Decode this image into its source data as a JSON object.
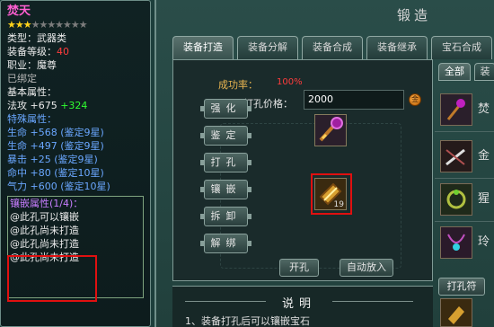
{
  "tooltip": {
    "item_name": "焚天",
    "stars_filled": 3,
    "stars_total": 10,
    "type_label": "类型：",
    "type_value": "武器类",
    "level_label": "装备等级：",
    "level_value": "40",
    "class_label": "职业：",
    "class_value": "魔尊",
    "bound": "已绑定",
    "base_attr_title": "基本属性：",
    "base_attr_name": "法攻",
    "base_attr_value": "+675",
    "base_attr_bonus": "+324",
    "special_attr_title": "特殊属性：",
    "special_attrs": [
      {
        "name": "生命",
        "value": "+568",
        "note": "(鉴定9星)"
      },
      {
        "name": "生命",
        "value": "+497",
        "note": "(鉴定9星)"
      },
      {
        "name": "暴击",
        "value": "+25",
        "note": "(鉴定9星)"
      },
      {
        "name": "命中",
        "value": "+80",
        "note": "(鉴定10星)"
      },
      {
        "name": "气力",
        "value": "+600",
        "note": "(鉴定10星)"
      }
    ],
    "socket_title": "镶嵌属性(1/4)：",
    "sockets": [
      "@此孔可以镶嵌",
      "@此孔尚未打造",
      "@此孔尚未打造",
      "@此孔尚未打造"
    ]
  },
  "panel": {
    "title": "锻造",
    "tabs": [
      "装备打造",
      "装备分解",
      "装备合成",
      "装备继承",
      "宝石合成"
    ],
    "success_rate_label": "成功率：",
    "success_rate_value": "100%",
    "punch_price_label": "打孔价格：",
    "punch_price_value": "2000",
    "coin_icon": "金",
    "actions": [
      "强化",
      "鉴定",
      "打孔",
      "镶嵌",
      "拆卸",
      "解绑"
    ],
    "gem_count": "19",
    "open_hole_label": "开孔",
    "auto_put_label": "自动放入",
    "desc_title": "说明",
    "desc_text": "1、装备打孔后可以镶嵌宝石"
  },
  "inventory": {
    "tab_all": "全部",
    "tab_other": "装",
    "items": [
      "焚",
      "金",
      "猩",
      "玲"
    ],
    "punch_tab": "打孔符"
  },
  "colors": {
    "item_name": "#ff5fd2",
    "rare_red": "#ff3c3c",
    "bonus_green": "#30ff30",
    "special_blue": "#6aa7ff",
    "highlight_red": "#e01010"
  }
}
